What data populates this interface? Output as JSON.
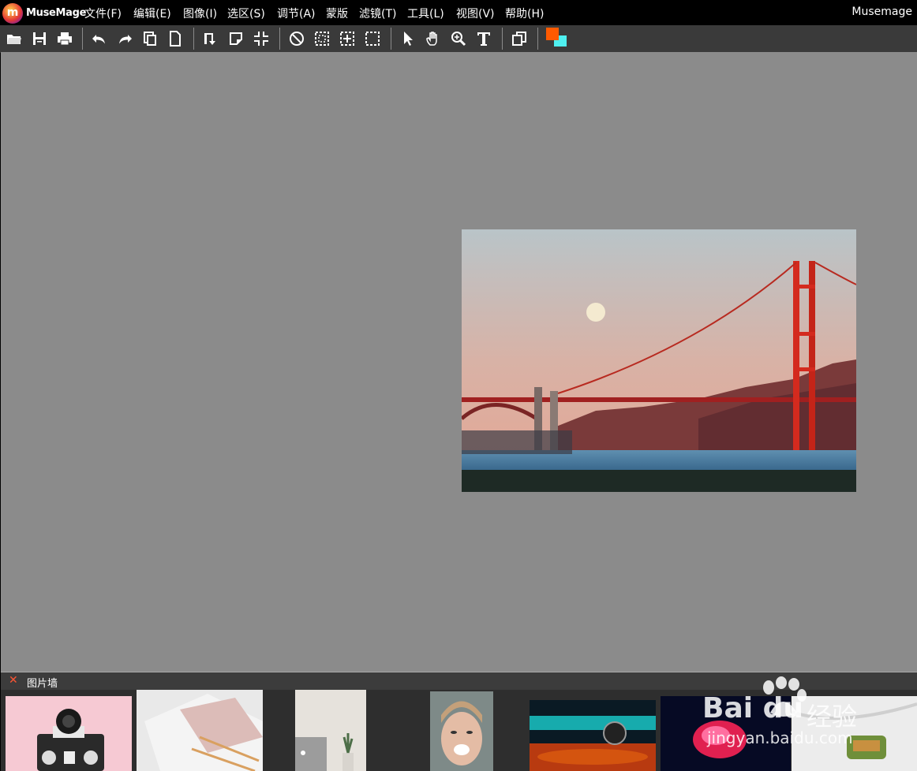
{
  "app": {
    "logo_text": "MuseMage",
    "logo_letter": "m",
    "title": "Musemage"
  },
  "menu": [
    {
      "id": "file",
      "label": "文件(F)"
    },
    {
      "id": "edit",
      "label": "编辑(E)"
    },
    {
      "id": "image",
      "label": "图像(I)"
    },
    {
      "id": "select",
      "label": "选区(S)"
    },
    {
      "id": "adjust",
      "label": "调节(A)"
    },
    {
      "id": "mask",
      "label": "蒙版"
    },
    {
      "id": "filter",
      "label": "滤镜(T)"
    },
    {
      "id": "tools",
      "label": "工具(L)"
    },
    {
      "id": "view",
      "label": "视图(V)"
    },
    {
      "id": "help",
      "label": "帮助(H)"
    }
  ],
  "toolbar": {
    "icons": [
      "open-folder-icon",
      "save-icon",
      "print-icon",
      "undo-icon",
      "redo-icon",
      "copy-icon",
      "new-page-icon",
      "rotate-icon",
      "crop-icon",
      "fit-icon",
      "deselect-icon",
      "select-rect-icon",
      "select-center-icon",
      "select-dashed-icon",
      "pointer-icon",
      "hand-icon",
      "zoom-icon",
      "text-icon",
      "layers-icon"
    ],
    "foreground_color": "#ff5a00",
    "background_color": "#4ff0f0"
  },
  "canvas": {
    "background": "#8b8b8b",
    "image": "golden-gate-bridge-photo"
  },
  "image_wall": {
    "close_symbol": "✕",
    "title": "图片墙",
    "thumbnails": [
      "camera-photo",
      "notebook-photo",
      "laptop-plant-photo",
      "smiling-woman-photo",
      "neon-sphere-photo",
      "glowing-hand-photo",
      "food-photo"
    ]
  },
  "watermark": {
    "brand": "Bai  du",
    "suffix": "经验",
    "url": "jingyan.baidu.com"
  }
}
